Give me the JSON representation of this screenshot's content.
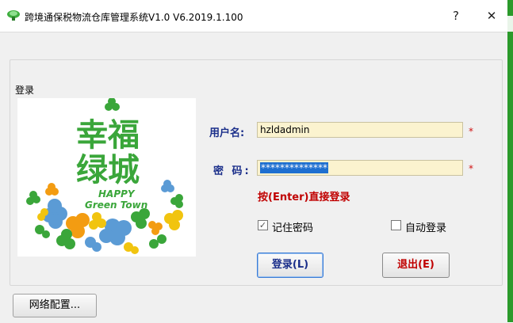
{
  "window": {
    "title": "跨境通保税物流仓库管理系统V1.0 V6.2019.1.100",
    "help_label": "?",
    "close_label": "✕",
    "icon": "green-gem-icon"
  },
  "login_group": {
    "label": "登录"
  },
  "logo": {
    "main_text": "幸福绿城",
    "line1": "幸福",
    "line2": "绿城",
    "english_line1": "HAPPY",
    "english_line2": "Green Town",
    "colors": {
      "green": "#3aa63a",
      "blue": "#5b9bd5",
      "orange": "#f39c12",
      "yellow": "#f1c40f"
    }
  },
  "form": {
    "username_label": "用户名:",
    "username_value": "hzldadmin",
    "password_label": "密 码:",
    "password_value": "**************",
    "required_mark": "*",
    "hint": "按(Enter)直接登录",
    "remember_label": "记住密码",
    "remember_checked": true,
    "auto_login_label": "自动登录",
    "auto_login_checked": false
  },
  "buttons": {
    "login": "登录(L)",
    "exit": "退出(E)",
    "network": "网络配置..."
  },
  "colors": {
    "label_blue": "#1a2e8a",
    "hint_red": "#c00000",
    "input_bg": "#fbf3cf",
    "selection": "#1e6fd0",
    "frame_green": "#2b9a2b"
  }
}
